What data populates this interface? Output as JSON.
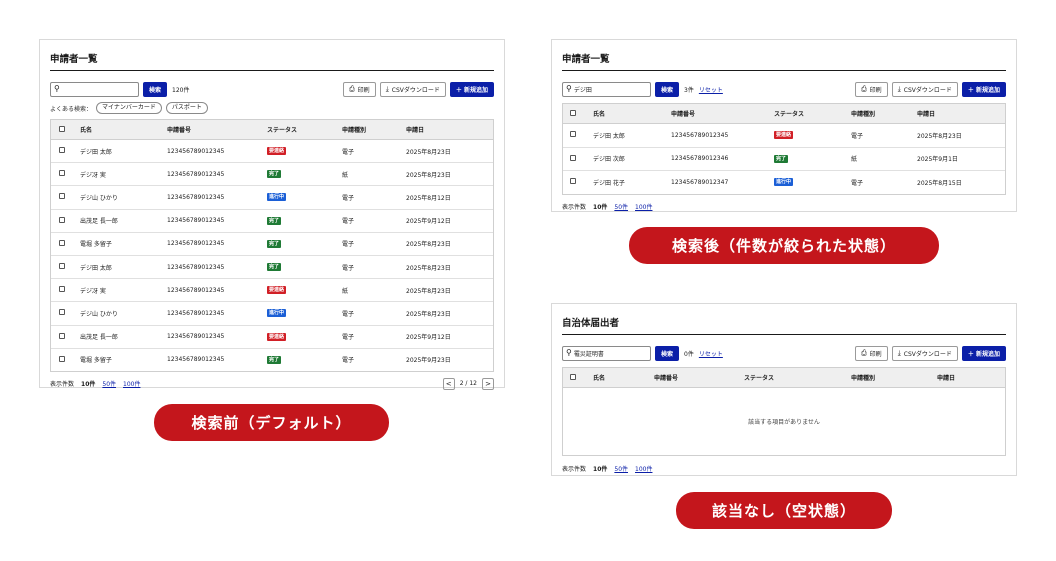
{
  "colors": {
    "accent": "#0b1fa8",
    "caption_bg": "#c4161c",
    "status_red": "#d11f26",
    "status_green": "#1f7a35",
    "status_blue": "#1b5fd6"
  },
  "columns": [
    "氏名",
    "申請番号",
    "ステータス",
    "申請種別",
    "申請日"
  ],
  "actions": {
    "search": "検索",
    "print": "印刷",
    "csv": "CSVダウンロード",
    "new": "＋ 新規追加",
    "reset": "リセット"
  },
  "icons": {
    "search": "search-icon",
    "print": "printer-icon",
    "download": "download-icon",
    "prev": "chevron-left-icon",
    "next": "chevron-right-icon"
  },
  "footer": {
    "label": "表示件数",
    "size_current": "10件",
    "size_50": "50件",
    "size_100": "100件"
  },
  "panel_before": {
    "title": "申請者一覧",
    "search_value": "",
    "count": "120件",
    "frequent_label": "よくある検索：",
    "chips": [
      "マイナンバーカード",
      "パスポート"
    ],
    "pager_prev": "<",
    "pager_info": "2 / 12",
    "pager_next": ">",
    "rows": [
      {
        "name": "デジ田 太郎",
        "id": "123456789012345",
        "status": "要連絡",
        "status_color": "#d11f26",
        "type": "電子",
        "date": "2025年8月23日"
      },
      {
        "name": "デジ冴 実",
        "id": "123456789012345",
        "status": "完了",
        "status_color": "#1f7a35",
        "type": "紙",
        "date": "2025年8月23日"
      },
      {
        "name": "デジ山 ひかり",
        "id": "123456789012345",
        "status": "進行中",
        "status_color": "#1b5fd6",
        "type": "電子",
        "date": "2025年8月12日"
      },
      {
        "name": "出茂足 長一郎",
        "id": "123456789012345",
        "status": "完了",
        "status_color": "#1f7a35",
        "type": "電子",
        "date": "2025年9月12日"
      },
      {
        "name": "電堀 多留子",
        "id": "123456789012345",
        "status": "完了",
        "status_color": "#1f7a35",
        "type": "電子",
        "date": "2025年8月23日"
      },
      {
        "name": "デジ田 太郎",
        "id": "123456789012345",
        "status": "完了",
        "status_color": "#1f7a35",
        "type": "電子",
        "date": "2025年8月23日"
      },
      {
        "name": "デジ冴 実",
        "id": "123456789012345",
        "status": "要連絡",
        "status_color": "#d11f26",
        "type": "紙",
        "date": "2025年8月23日"
      },
      {
        "name": "デジ山 ひかり",
        "id": "123456789012345",
        "status": "進行中",
        "status_color": "#1b5fd6",
        "type": "電子",
        "date": "2025年8月23日"
      },
      {
        "name": "出茂足 長一郎",
        "id": "123456789012345",
        "status": "要連絡",
        "status_color": "#d11f26",
        "type": "電子",
        "date": "2025年9月12日"
      },
      {
        "name": "電堀 多留子",
        "id": "123456789012345",
        "status": "完了",
        "status_color": "#1f7a35",
        "type": "電子",
        "date": "2025年9月23日"
      }
    ]
  },
  "panel_after": {
    "title": "申請者一覧",
    "search_value": "デジ田",
    "count": "3件",
    "rows": [
      {
        "name": "デジ田 太郎",
        "id": "123456789012345",
        "status": "要連絡",
        "status_color": "#d11f26",
        "type": "電子",
        "date": "2025年8月23日"
      },
      {
        "name": "デジ田 次郎",
        "id": "123456789012346",
        "status": "完了",
        "status_color": "#1f7a35",
        "type": "紙",
        "date": "2025年9月1日"
      },
      {
        "name": "デジ田 花子",
        "id": "123456789012347",
        "status": "進行中",
        "status_color": "#1b5fd6",
        "type": "電子",
        "date": "2025年8月15日"
      }
    ]
  },
  "panel_empty": {
    "title": "自治体届出者",
    "search_value": "罹災証明書",
    "count": "0件",
    "empty_message": "該当する項目がありません"
  },
  "captions": {
    "before": "検索前（デフォルト）",
    "after": "検索後（件数が絞られた状態）",
    "empty": "該当なし（空状態）"
  }
}
